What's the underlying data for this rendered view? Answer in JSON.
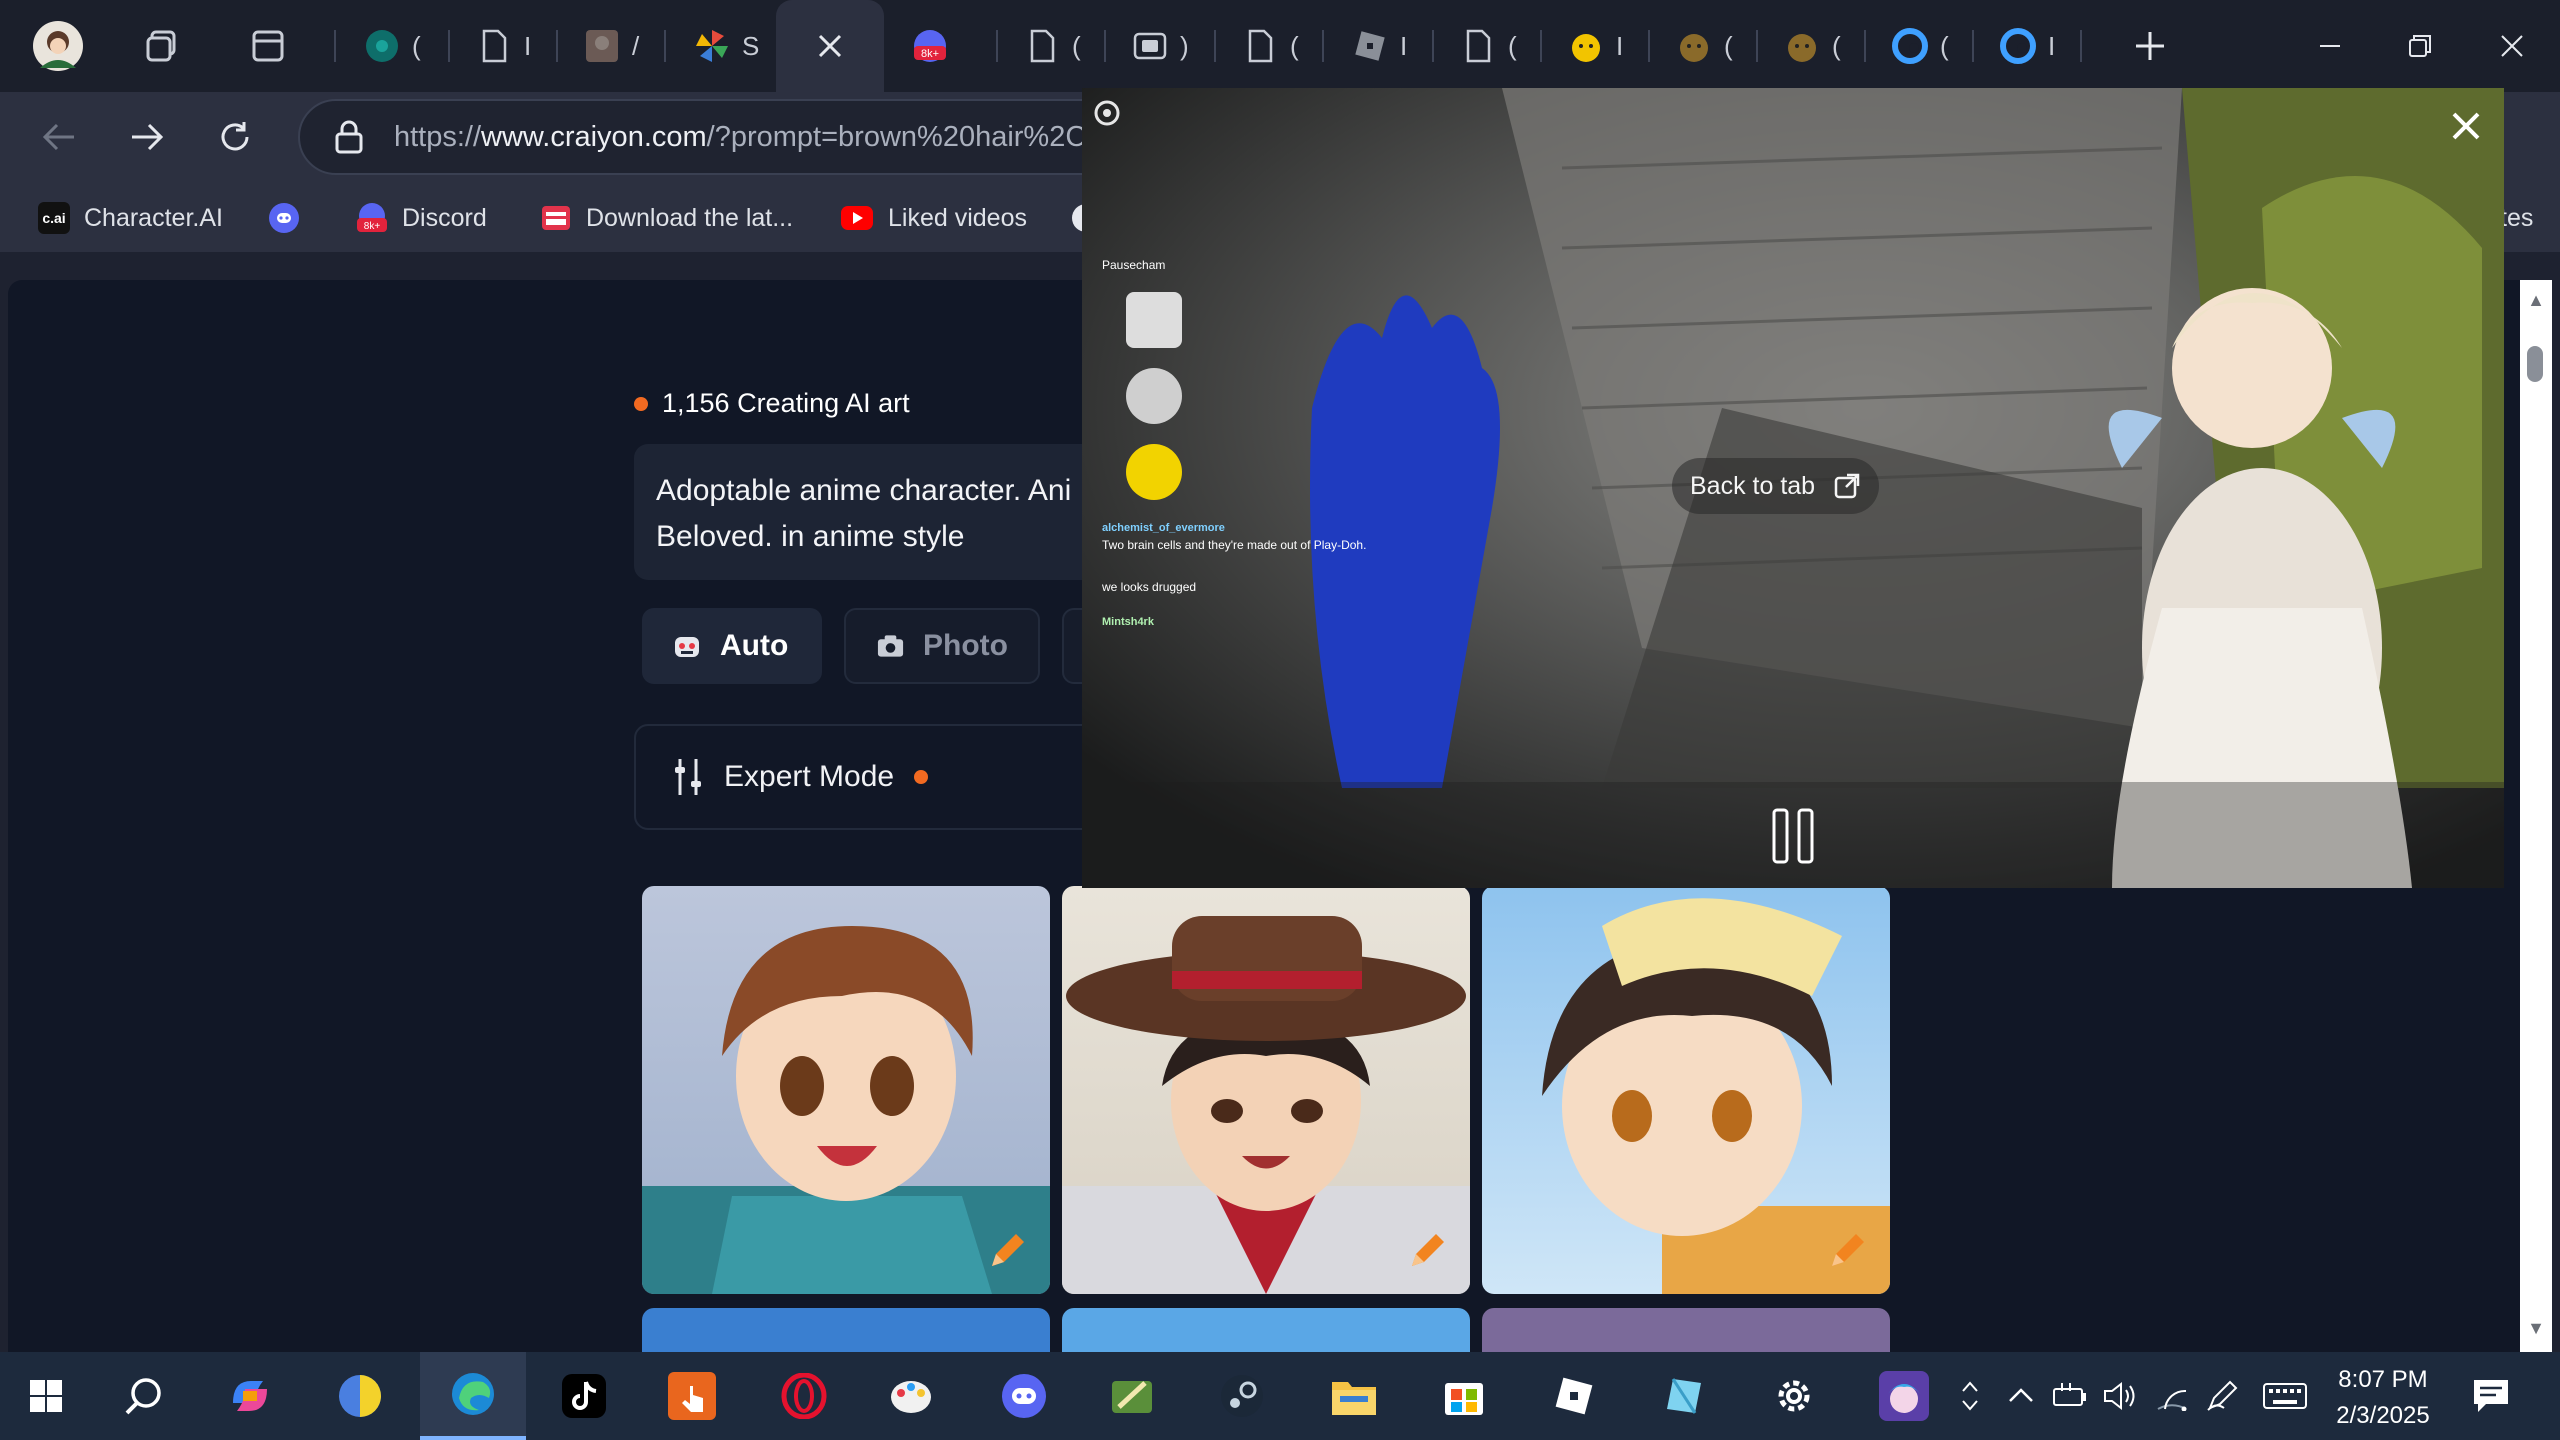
{
  "browser": {
    "tabs": [
      {
        "name": "tab-profile",
        "label": ""
      },
      {
        "name": "tab-1",
        "label": "("
      },
      {
        "name": "tab-2",
        "label": "I"
      },
      {
        "name": "tab-3",
        "label": "/"
      },
      {
        "name": "tab-4",
        "label": "S"
      },
      {
        "name": "tab-active",
        "label": ""
      },
      {
        "name": "tab-5",
        "label": "("
      },
      {
        "name": "tab-6",
        "label": ")"
      },
      {
        "name": "tab-7",
        "label": "("
      },
      {
        "name": "tab-8",
        "label": "I"
      },
      {
        "name": "tab-9",
        "label": "("
      },
      {
        "name": "tab-10",
        "label": "I"
      },
      {
        "name": "tab-11",
        "label": "("
      },
      {
        "name": "tab-12",
        "label": "("
      },
      {
        "name": "tab-13",
        "label": "("
      },
      {
        "name": "tab-14",
        "label": "I"
      },
      {
        "name": "tab-15",
        "label": "I"
      }
    ],
    "url_prefix": "https://",
    "url_host": "www.craiyon.com",
    "url_path": "/?prompt=brown%20hair%2C%",
    "bookmarks": [
      {
        "label": "Character.AI",
        "icon_text": "c.ai"
      },
      {
        "label": "",
        "icon_text": ""
      },
      {
        "label": "Discord",
        "icon_text": "8k+"
      },
      {
        "label": "Download the lat...",
        "icon_text": ""
      },
      {
        "label": "Liked videos",
        "icon_text": "▶"
      },
      {
        "label": "tes",
        "icon_text": ""
      }
    ]
  },
  "page": {
    "counter": "1,156 Creating AI art",
    "prompt_text": "Adoptable anime character. Ani Beloved. in anime style",
    "mode_auto": "Auto",
    "mode_photo": "Photo",
    "expert_mode": "Expert Mode"
  },
  "pip": {
    "back_to_tab": "Back to tab",
    "chat": [
      {
        "user": "",
        "text": "Pausecham"
      },
      {
        "user": "",
        "text": ""
      },
      {
        "user": "",
        "text": ""
      },
      {
        "user": "",
        "text": ""
      },
      {
        "user": "alchemist_of_evermore",
        "text": "Two brain cells and they're made out of Play-Doh."
      },
      {
        "user": "",
        "text": "we looks drugged"
      },
      {
        "user": "Mintsh4rk",
        "text": ""
      }
    ]
  },
  "taskbar": {
    "time": "8:07 PM",
    "date": "2/3/2025"
  },
  "colors": {
    "accent": "#f26a21",
    "page_bg": "#111726",
    "taskbar_bg": "#1d2a3d"
  }
}
